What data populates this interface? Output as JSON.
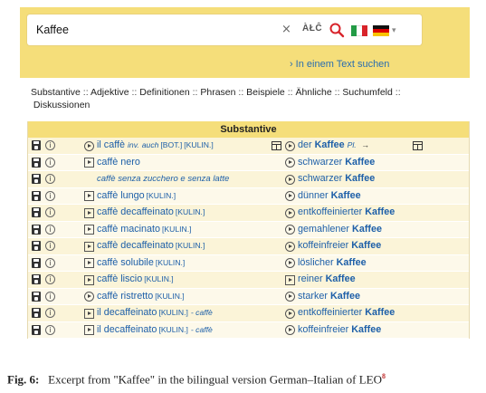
{
  "search": {
    "query": "Kaffee",
    "clear_symbol": "×",
    "special_chars_label": "ÀŁĈ",
    "text_search_link": "In einem Text suchen"
  },
  "categories": [
    "Substantive",
    "Adjektive",
    "Definitionen",
    "Phrasen",
    "Beispiele",
    "Ähnliche",
    "Suchumfeld",
    "Diskussionen"
  ],
  "section_title": "Substantive",
  "rows": [
    {
      "it": "il caffè",
      "it_tags": [
        "inv.",
        "auch",
        "[BOT.]",
        "[KULIN.]"
      ],
      "de": "der Kaffee",
      "de_bold": "Kaffee",
      "de_extra": "Pl.",
      "it_icon": "play-circle",
      "de_icon": "play-circle"
    },
    {
      "it": "caffè nero",
      "it_tags": [],
      "de": "schwarzer Kaffee",
      "de_bold": "Kaffee",
      "it_icon": "play-square",
      "de_icon": "play-circle"
    },
    {
      "it": "caffè senza zucchero e senza latte",
      "it_tags": [],
      "de": "schwarzer Kaffee",
      "de_bold": "Kaffee",
      "it_icon": "none",
      "de_icon": "play-circle"
    },
    {
      "it": "caffè lungo",
      "it_tags": [
        "[KULIN.]"
      ],
      "de": "dünner Kaffee",
      "de_bold": "Kaffee",
      "it_icon": "play-square",
      "de_icon": "play-circle"
    },
    {
      "it": "caffè decaffeinato",
      "it_tags": [
        "[KULIN.]"
      ],
      "de": "entkoffeinierter Kaffee",
      "de_bold": "Kaffee",
      "it_icon": "play-square",
      "de_icon": "play-circle"
    },
    {
      "it": "caffè macinato",
      "it_tags": [
        "[KULIN.]"
      ],
      "de": "gemahlener Kaffee",
      "de_bold": "Kaffee",
      "it_icon": "play-square",
      "de_icon": "play-circle"
    },
    {
      "it": "caffè decaffeinato",
      "it_tags": [
        "[KULIN.]"
      ],
      "de": "koffeinfreier Kaffee",
      "de_bold": "Kaffee",
      "it_icon": "play-square",
      "de_icon": "play-circle"
    },
    {
      "it": "caffè solubile",
      "it_tags": [
        "[KULIN.]"
      ],
      "de": "löslicher Kaffee",
      "de_bold": "Kaffee",
      "it_icon": "play-square",
      "de_icon": "play-circle"
    },
    {
      "it": "caffè liscio",
      "it_tags": [
        "[KULIN.]"
      ],
      "de": "reiner Kaffee",
      "de_bold": "Kaffee",
      "it_icon": "play-square",
      "de_icon": "play-square"
    },
    {
      "it": "caffè ristretto",
      "it_tags": [
        "[KULIN.]"
      ],
      "de": "starker Kaffee",
      "de_bold": "Kaffee",
      "it_icon": "play-circle",
      "de_icon": "play-circle"
    },
    {
      "it": "il decaffeinato",
      "it_tags": [
        "[KULIN.]",
        "- caffè"
      ],
      "de": "entkoffeinierter Kaffee",
      "de_bold": "Kaffee",
      "it_icon": "play-square",
      "de_icon": "play-circle"
    },
    {
      "it": "il decaffeinato",
      "it_tags": [
        "[KULIN.]",
        "- caffè"
      ],
      "de": "koffeinfreier Kaffee",
      "de_bold": "Kaffee",
      "it_icon": "play-square",
      "de_icon": "play-circle"
    }
  ],
  "caption": {
    "label": "Fig. 6:",
    "text": "Excerpt from \"Kaffee\" in the bilingual version German–Italian of LEO",
    "footnote": "8"
  },
  "colors": {
    "panel_yellow": "#f5de7a",
    "row_odd": "#fbf4d8",
    "row_even": "#fdf9ea",
    "link_blue": "#1d5fa8",
    "search_red": "#d8232a"
  }
}
